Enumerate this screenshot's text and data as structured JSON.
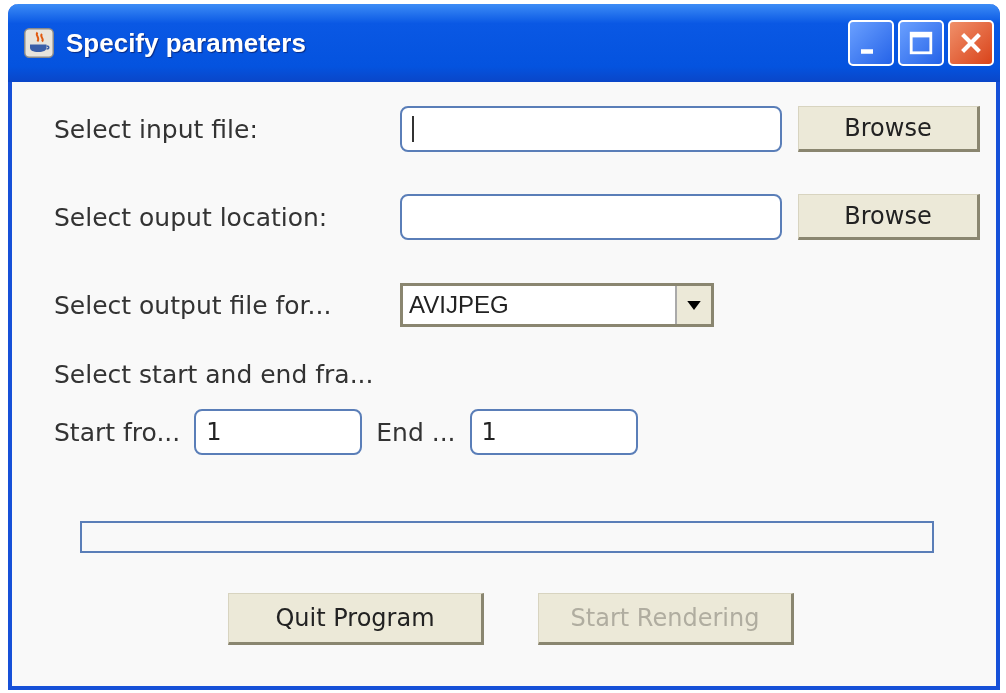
{
  "window": {
    "title": "Specify parameters"
  },
  "input_file": {
    "label": "Select input file:",
    "focused": true,
    "button": "Browse"
  },
  "output_location": {
    "label": "Select ouput location:",
    "focused": false,
    "button": "Browse"
  },
  "output_format": {
    "label": "Select output file for...",
    "value": "AVIJPEG"
  },
  "frames": {
    "label": "Select start and end fra...",
    "start_label": "Start fro...",
    "start_value": "1",
    "end_label": "End ...",
    "end_value": "1"
  },
  "progress": {
    "level": 0
  },
  "buttons": [
    {
      "label": "Quit Program",
      "disabled": false
    },
    {
      "label": "Start Rendering",
      "disabled": true
    }
  ]
}
